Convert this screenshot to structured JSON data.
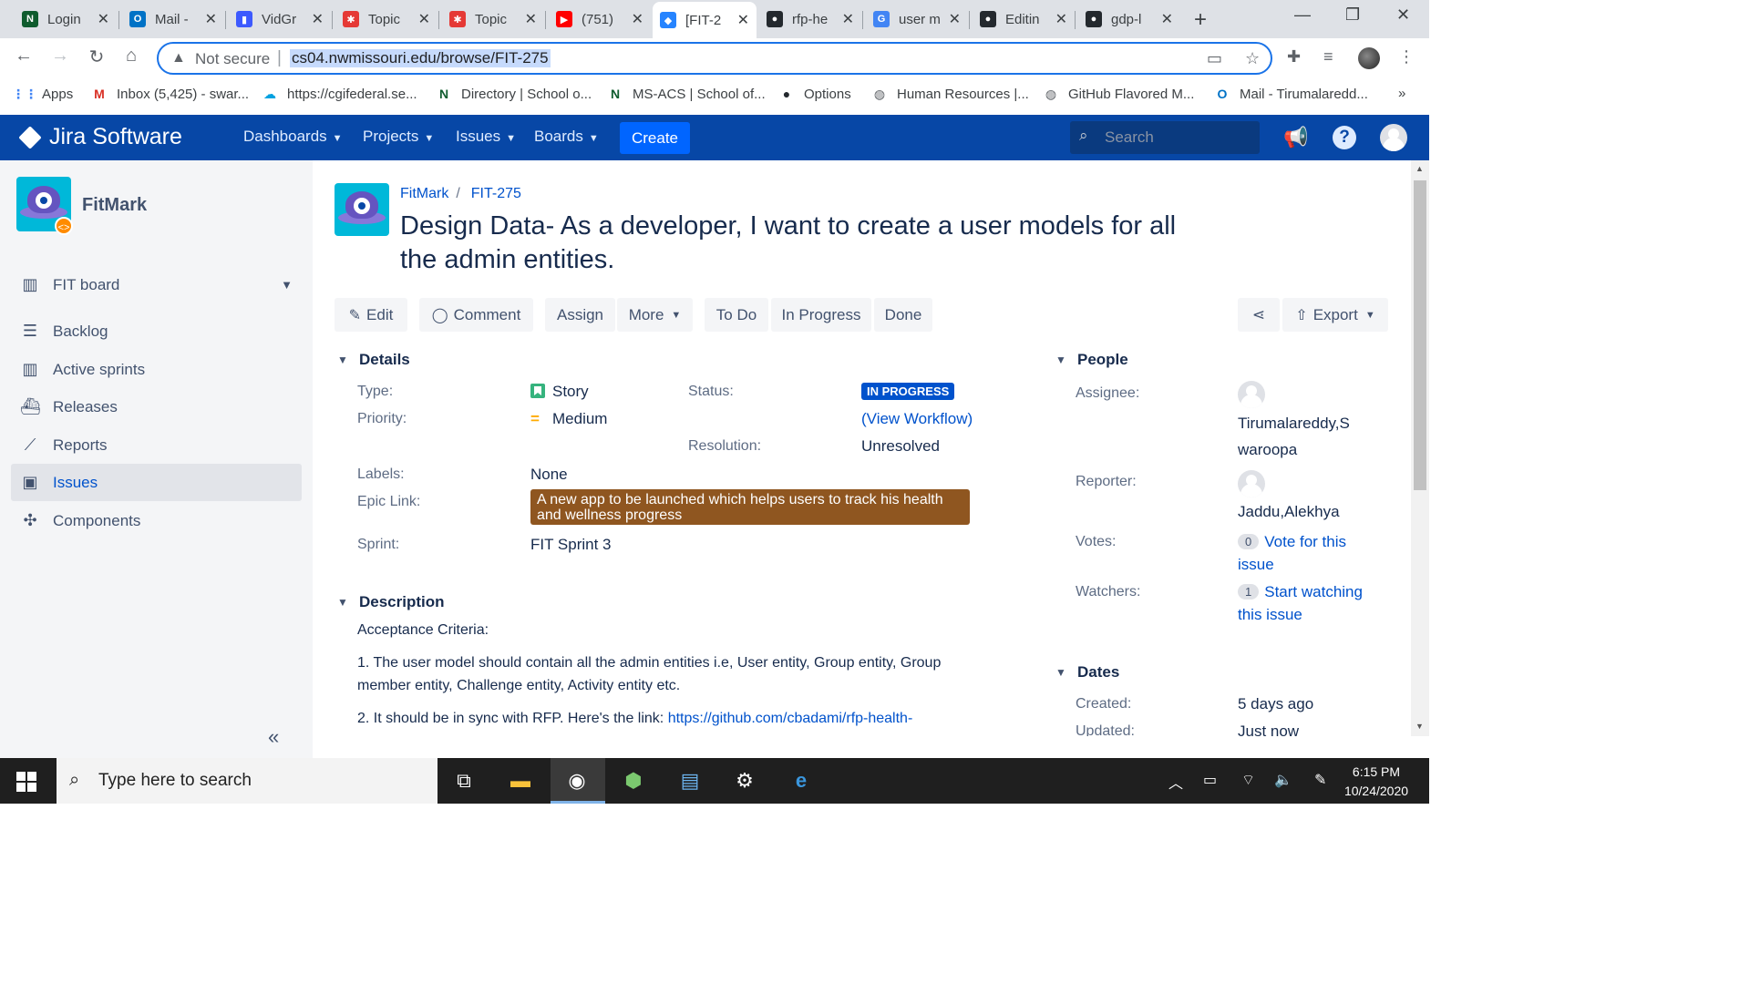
{
  "browser": {
    "tabs": [
      {
        "label": "Login",
        "fav": "N",
        "favcolor": "#0f5c2e",
        "fav_icon": "n-logo-icon"
      },
      {
        "label": "Mail -",
        "fav": "O",
        "favcolor": "#0072c6",
        "fav_icon": "outlook-icon"
      },
      {
        "label": "VidGr",
        "fav": "▮",
        "favcolor": "#3d5afe",
        "fav_icon": "vidgrid-icon"
      },
      {
        "label": "Topic",
        "fav": "✱",
        "favcolor": "#e53935",
        "fav_icon": "topic-icon"
      },
      {
        "label": "Topic",
        "fav": "✱",
        "favcolor": "#e53935",
        "fav_icon": "topic-icon"
      },
      {
        "label": "(751)",
        "fav": "▶",
        "favcolor": "#ff0000",
        "fav_icon": "youtube-icon"
      },
      {
        "label": "[FIT-2",
        "fav": "◆",
        "favcolor": "#2684ff",
        "fav_icon": "jira-icon",
        "active": true
      },
      {
        "label": "rfp-he",
        "fav": "●",
        "favcolor": "#24292e",
        "fav_icon": "github-icon"
      },
      {
        "label": "user m",
        "fav": "G",
        "favcolor": "#4285f4",
        "fav_icon": "google-icon"
      },
      {
        "label": "Editin",
        "fav": "●",
        "favcolor": "#24292e",
        "fav_icon": "github-icon"
      },
      {
        "label": "gdp-l",
        "fav": "●",
        "favcolor": "#24292e",
        "fav_icon": "github-icon"
      }
    ],
    "address": {
      "security": "Not secure",
      "url": "cs04.nwmissouri.edu/browse/FIT-275"
    },
    "bookmarks": [
      {
        "label": "Apps",
        "icon": "apps-grid-icon"
      },
      {
        "label": "Inbox (5,425) - swar...",
        "icon": "gmail-icon"
      },
      {
        "label": "https://cgifederal.se...",
        "icon": "salesforce-icon"
      },
      {
        "label": "Directory | School o...",
        "icon": "n-logo-icon"
      },
      {
        "label": "MS-ACS | School of...",
        "icon": "n-logo-icon"
      },
      {
        "label": "Options",
        "icon": "github-icon"
      },
      {
        "label": "Human Resources |...",
        "icon": "globe-icon"
      },
      {
        "label": "GitHub Flavored M...",
        "icon": "globe-icon"
      },
      {
        "label": "Mail - Tirumalaredd...",
        "icon": "outlook-icon"
      }
    ]
  },
  "jira": {
    "brand": "Jira Software",
    "menu": [
      "Dashboards",
      "Projects",
      "Issues",
      "Boards"
    ],
    "create": "Create",
    "search_placeholder": "Search"
  },
  "sidebar": {
    "project_name": "FitMark",
    "items": [
      {
        "label": "FIT board",
        "icon": "board-icon"
      },
      {
        "label": "Backlog",
        "icon": "backlog-icon"
      },
      {
        "label": "Active sprints",
        "icon": "sprints-icon"
      },
      {
        "label": "Releases",
        "icon": "releases-icon"
      },
      {
        "label": "Reports",
        "icon": "reports-icon"
      },
      {
        "label": "Issues",
        "icon": "issues-icon",
        "active": true
      },
      {
        "label": "Components",
        "icon": "components-icon"
      }
    ]
  },
  "issue": {
    "breadcrumb": [
      "FitMark",
      "FIT-275"
    ],
    "title": "Design Data- As a developer, I want to create a user models for all the admin entities.",
    "ops": [
      "Edit",
      "Comment",
      "Assign",
      "More",
      "To Do",
      "In Progress",
      "Done",
      "Export"
    ],
    "details_heading": "Details",
    "details": {
      "type_label": "Type:",
      "type": "Story",
      "priority_label": "Priority:",
      "priority": "Medium",
      "status_label": "Status:",
      "status": "IN PROGRESS",
      "view_workflow": "(View Workflow)",
      "resolution_label": "Resolution:",
      "resolution": "Unresolved",
      "labels_label": "Labels:",
      "labels": "None",
      "epic_label": "Epic Link:",
      "epic": "A new app to be launched which helps users to track his health and wellness progress",
      "sprint_label": "Sprint:",
      "sprint": "FIT Sprint 3"
    },
    "description_heading": "Description",
    "description": {
      "intro": "Acceptance Criteria:",
      "p1": "1.  The user model should contain all the admin entities i.e, User entity, Group entity, Group member entity, Challenge entity, Activity entity etc.",
      "p2_text": "2. It should be in sync with RFP. Here's the link: ",
      "p2_link": "https://github.com/cbadami/rfp-health-"
    },
    "people_heading": "People",
    "people": {
      "assignee_label": "Assignee:",
      "assignee_line1": "Tirumalareddy,S",
      "assignee_line2": "waroopa",
      "reporter_label": "Reporter:",
      "reporter": "Jaddu,Alekhya",
      "votes_label": "Votes:",
      "votes_count": "0",
      "votes_link1": "Vote for this",
      "votes_link2": "issue",
      "watchers_label": "Watchers:",
      "watchers_count": "1",
      "watchers_link1": "Start watching",
      "watchers_link2": "this issue"
    },
    "dates_heading": "Dates",
    "dates": {
      "created_label": "Created:",
      "created": "5 days ago",
      "updated_label": "Updated:",
      "updated": "Just now"
    }
  },
  "taskbar": {
    "search_placeholder": "Type here to search",
    "time": "6:15 PM",
    "date": "10/24/2020"
  }
}
